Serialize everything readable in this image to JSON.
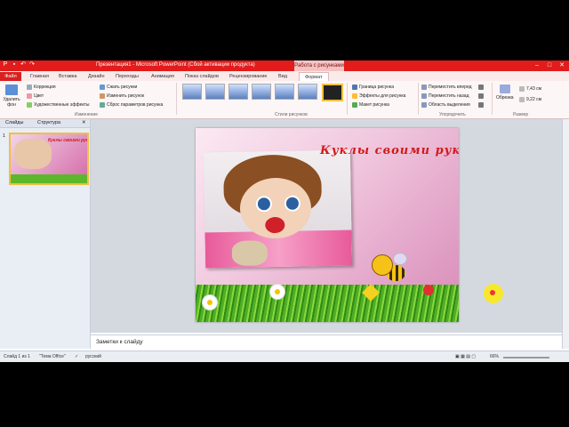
{
  "window": {
    "title": "Презентация1 - Microsoft PowerPoint (Сбой активации продукта)",
    "context_tab_header": "Работа с рисунками"
  },
  "tabs": [
    "Файл",
    "Главная",
    "Вставка",
    "Дизайн",
    "Переходы",
    "Анимация",
    "Показ слайдов",
    "Рецензирование",
    "Вид",
    "Формат"
  ],
  "ribbon": {
    "remove_bg": "Удалить фон",
    "adjust": [
      "Коррекция",
      "Цвет",
      "Художественные эффекты"
    ],
    "adjust2": [
      "Сжать рисунки",
      "Изменить рисунок",
      "Сброс параметров рисунка"
    ],
    "group_change": "Изменение",
    "group_styles": "Стили рисунков",
    "picture_opts": [
      "Граница рисунка",
      "Эффекты для рисунка",
      "Макет рисунка"
    ],
    "arrange": [
      "Переместить вперед",
      "Переместить назад",
      "Область выделения"
    ],
    "group_arrange": "Упорядочить",
    "crop": "Обрезка",
    "height": "7,43 см",
    "width": "9,22 см",
    "group_size": "Размер"
  },
  "panel": {
    "tab_slides": "Слайды",
    "tab_outline": "Структура",
    "slide_number": "1"
  },
  "slide": {
    "title": "Куклы своими руками"
  },
  "notes_placeholder": "Заметки к слайду",
  "status": {
    "slide": "Слайд 1 из 1",
    "theme": "\"Тема Office\"",
    "language": "русский",
    "zoom": "66%"
  },
  "colors": {
    "accent": "#e21b1b",
    "context_tab": "#f4c2c2"
  }
}
